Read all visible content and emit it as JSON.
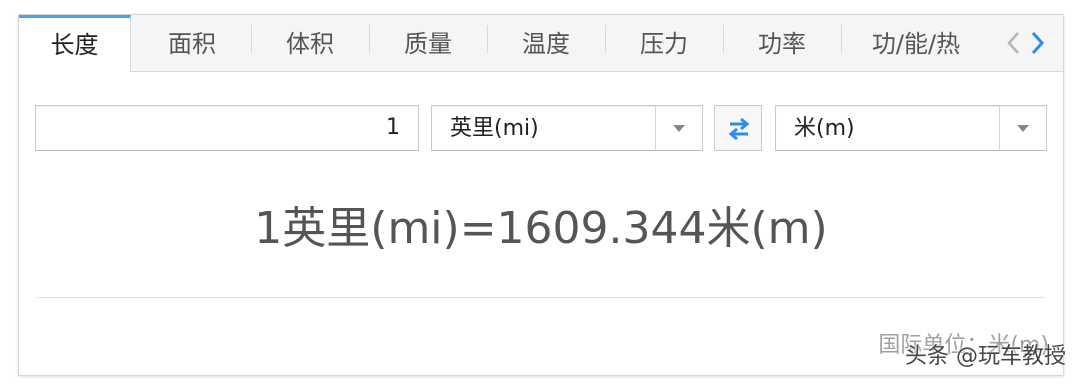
{
  "tabs": [
    {
      "label": "长度",
      "active": true
    },
    {
      "label": "面积"
    },
    {
      "label": "体积"
    },
    {
      "label": "质量"
    },
    {
      "label": "温度"
    },
    {
      "label": "压力"
    },
    {
      "label": "功率"
    },
    {
      "label": "功/能/热"
    }
  ],
  "nav": {
    "prev_icon": "chevron-left-icon",
    "next_icon": "chevron-right-icon"
  },
  "converter": {
    "input_value": "1",
    "from_unit": "英里(mi)",
    "to_unit": "米(m)",
    "swap_icon": "swap-arrows-icon"
  },
  "result_text": "1英里(mi)=1609.344米(m)",
  "standard_unit": "国际单位：米(m)",
  "watermark": "头条 @玩车教授",
  "colors": {
    "accent": "#4aa3ee",
    "swap": "#2d8cf0"
  }
}
